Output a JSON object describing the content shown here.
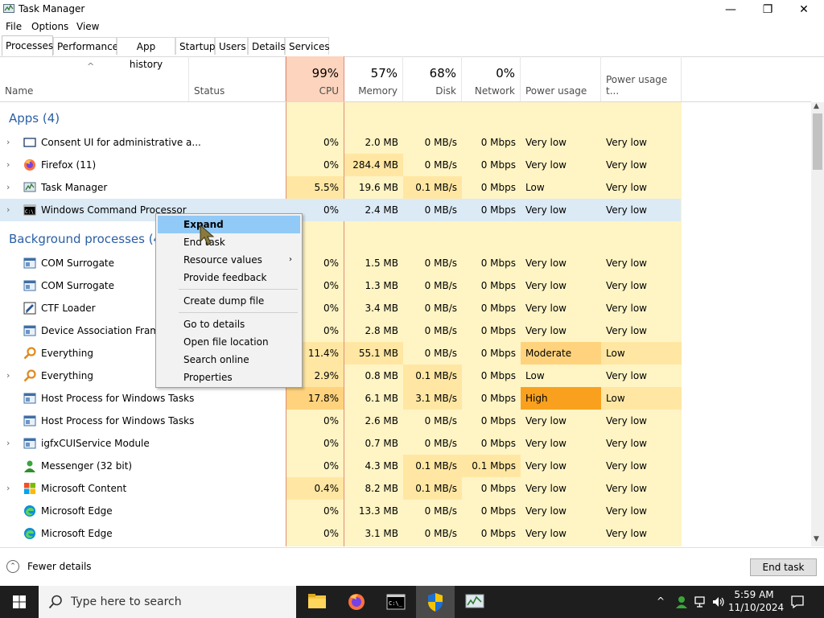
{
  "window": {
    "title": "Task Manager",
    "minimize_glyph": "—",
    "maximize_glyph": "❐",
    "close_glyph": "✕"
  },
  "menu": [
    "File",
    "Options",
    "View"
  ],
  "tabs": [
    {
      "label": "Processes",
      "active": true
    },
    {
      "label": "Performance"
    },
    {
      "label": "App history"
    },
    {
      "label": "Startup"
    },
    {
      "label": "Users"
    },
    {
      "label": "Details"
    },
    {
      "label": "Services"
    }
  ],
  "columns": {
    "name": "Name",
    "status": "Status",
    "cpu": {
      "pct": "99%",
      "label": "CPU"
    },
    "memory": {
      "pct": "57%",
      "label": "Memory"
    },
    "disk": {
      "pct": "68%",
      "label": "Disk"
    },
    "network": {
      "pct": "0%",
      "label": "Network"
    },
    "power": "Power usage",
    "power_trend": "Power usage t..."
  },
  "groups": {
    "apps": "Apps (4)",
    "background": "Background processes (47"
  },
  "apps": [
    {
      "name": "Consent UI for administrative a...",
      "icon": "window-icon",
      "cpu": "0%",
      "mem": "2.0 MB",
      "disk": "0 MB/s",
      "net": "0 Mbps",
      "power": "Very low",
      "trend": "Very low"
    },
    {
      "name": "Firefox (11)",
      "icon": "firefox-icon",
      "cpu": "0%",
      "mem": "284.4 MB",
      "disk": "0 MB/s",
      "net": "0 Mbps",
      "power": "Very low",
      "trend": "Very low"
    },
    {
      "name": "Task Manager",
      "icon": "task-manager-icon",
      "cpu": "5.5%",
      "mem": "19.6 MB",
      "disk": "0.1 MB/s",
      "net": "0 Mbps",
      "power": "Low",
      "trend": "Very low"
    },
    {
      "name": "Windows Command Processor",
      "icon": "cmd-icon",
      "cpu": "0%",
      "mem": "2.4 MB",
      "disk": "0 MB/s",
      "net": "0 Mbps",
      "power": "Very low",
      "trend": "Very low"
    }
  ],
  "background": [
    {
      "name": "COM Surrogate",
      "icon": "service-icon",
      "cpu": "0%",
      "mem": "1.5 MB",
      "disk": "0 MB/s",
      "net": "0 Mbps",
      "power": "Very low",
      "trend": "Very low"
    },
    {
      "name": "COM Surrogate",
      "icon": "service-icon",
      "cpu": "0%",
      "mem": "1.3 MB",
      "disk": "0 MB/s",
      "net": "0 Mbps",
      "power": "Very low",
      "trend": "Very low"
    },
    {
      "name": "CTF Loader",
      "icon": "ctf-icon",
      "cpu": "0%",
      "mem": "3.4 MB",
      "disk": "0 MB/s",
      "net": "0 Mbps",
      "power": "Very low",
      "trend": "Very low"
    },
    {
      "name": "Device Association Framew",
      "icon": "service-icon",
      "cpu": "0%",
      "mem": "2.8 MB",
      "disk": "0 MB/s",
      "net": "0 Mbps",
      "power": "Very low",
      "trend": "Very low"
    },
    {
      "name": "Everything",
      "icon": "search-key-icon",
      "cpu": "11.4%",
      "mem": "55.1 MB",
      "disk": "0 MB/s",
      "net": "0 Mbps",
      "power": "Moderate",
      "trend": "Low"
    },
    {
      "name": "Everything",
      "icon": "search-key-icon",
      "cpu": "2.9%",
      "mem": "0.8 MB",
      "disk": "0.1 MB/s",
      "net": "0 Mbps",
      "power": "Low",
      "trend": "Very low"
    },
    {
      "name": "Host Process for Windows Tasks",
      "icon": "service-icon",
      "cpu": "17.8%",
      "mem": "6.1 MB",
      "disk": "3.1 MB/s",
      "net": "0 Mbps",
      "power": "High",
      "trend": "Low"
    },
    {
      "name": "Host Process for Windows Tasks",
      "icon": "service-icon",
      "cpu": "0%",
      "mem": "2.6 MB",
      "disk": "0 MB/s",
      "net": "0 Mbps",
      "power": "Very low",
      "trend": "Very low"
    },
    {
      "name": "igfxCUIService Module",
      "icon": "service-icon",
      "cpu": "0%",
      "mem": "0.7 MB",
      "disk": "0 MB/s",
      "net": "0 Mbps",
      "power": "Very low",
      "trend": "Very low"
    },
    {
      "name": "Messenger (32 bit)",
      "icon": "messenger-icon",
      "cpu": "0%",
      "mem": "4.3 MB",
      "disk": "0.1 MB/s",
      "net": "0.1 Mbps",
      "power": "Very low",
      "trend": "Very low"
    },
    {
      "name": "Microsoft Content",
      "icon": "microsoft-icon",
      "cpu": "0.4%",
      "mem": "8.2 MB",
      "disk": "0.1 MB/s",
      "net": "0 Mbps",
      "power": "Very low",
      "trend": "Very low"
    },
    {
      "name": "Microsoft Edge",
      "icon": "edge-icon",
      "cpu": "0%",
      "mem": "13.3 MB",
      "disk": "0 MB/s",
      "net": "0 Mbps",
      "power": "Very low",
      "trend": "Very low"
    },
    {
      "name": "Microsoft Edge",
      "icon": "edge-icon",
      "cpu": "0%",
      "mem": "3.1 MB",
      "disk": "0 MB/s",
      "net": "0 Mbps",
      "power": "Very low",
      "trend": "Very low"
    }
  ],
  "context_menu": {
    "items": [
      "Expand",
      "End task",
      "Resource values",
      "Provide feedback",
      "Create dump file",
      "Go to details",
      "Open file location",
      "Search online",
      "Properties"
    ],
    "submenu_arrow": "›"
  },
  "footer": {
    "fewer_details": "Fewer details",
    "end_task": "End task"
  },
  "taskbar": {
    "search_placeholder": "Type here to search",
    "time": "5:59 AM",
    "date": "11/10/2024"
  },
  "colors": {
    "cpu_header": "#fdd4bd",
    "heat_low": "#fff4c4",
    "heat_mid": "#ffe7a3",
    "heat_high": "#ffd37d",
    "power_moderate": "#ffd37d",
    "power_high": "#f9a11e",
    "selection": "#dbeaf5",
    "group_blue": "#2a5fa3"
  }
}
